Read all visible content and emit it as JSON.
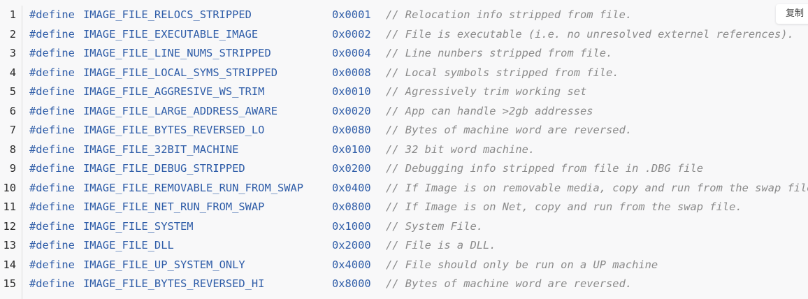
{
  "copy_label": "复制",
  "keyword": "#define",
  "lines": [
    {
      "num": "1",
      "name": "IMAGE_FILE_RELOCS_STRIPPED",
      "value": "0x0001",
      "comment": "// Relocation info stripped from file."
    },
    {
      "num": "2",
      "name": "IMAGE_FILE_EXECUTABLE_IMAGE",
      "value": "0x0002",
      "comment": "// File is executable  (i.e. no unresolved externel references)."
    },
    {
      "num": "3",
      "name": "IMAGE_FILE_LINE_NUMS_STRIPPED",
      "value": "0x0004",
      "comment": "// Line nunbers stripped from file."
    },
    {
      "num": "4",
      "name": "IMAGE_FILE_LOCAL_SYMS_STRIPPED",
      "value": "0x0008",
      "comment": "// Local symbols stripped from file."
    },
    {
      "num": "5",
      "name": "IMAGE_FILE_AGGRESIVE_WS_TRIM",
      "value": "0x0010",
      "comment": "// Agressively trim working set"
    },
    {
      "num": "6",
      "name": "IMAGE_FILE_LARGE_ADDRESS_AWARE",
      "value": "0x0020",
      "comment": "// App can handle >2gb addresses"
    },
    {
      "num": "7",
      "name": "IMAGE_FILE_BYTES_REVERSED_LO",
      "value": "0x0080",
      "comment": "// Bytes of machine word are reversed."
    },
    {
      "num": "8",
      "name": "IMAGE_FILE_32BIT_MACHINE",
      "value": "0x0100",
      "comment": "// 32 bit word machine."
    },
    {
      "num": "9",
      "name": "IMAGE_FILE_DEBUG_STRIPPED",
      "value": "0x0200",
      "comment": "// Debugging info stripped from file in .DBG file"
    },
    {
      "num": "10",
      "name": "IMAGE_FILE_REMOVABLE_RUN_FROM_SWAP",
      "value": "0x0400",
      "comment": "// If Image is on removable media, copy and run from the swap file."
    },
    {
      "num": "11",
      "name": "IMAGE_FILE_NET_RUN_FROM_SWAP",
      "value": "0x0800",
      "comment": "// If Image is on Net, copy and run from the swap file."
    },
    {
      "num": "12",
      "name": "IMAGE_FILE_SYSTEM",
      "value": "0x1000",
      "comment": "// System File."
    },
    {
      "num": "13",
      "name": "IMAGE_FILE_DLL",
      "value": "0x2000",
      "comment": "// File is a DLL."
    },
    {
      "num": "14",
      "name": "IMAGE_FILE_UP_SYSTEM_ONLY",
      "value": "0x4000",
      "comment": "// File should only be run on a UP machine"
    },
    {
      "num": "15",
      "name": "IMAGE_FILE_BYTES_REVERSED_HI",
      "value": "0x8000",
      "comment": "// Bytes of machine word are reversed."
    }
  ]
}
